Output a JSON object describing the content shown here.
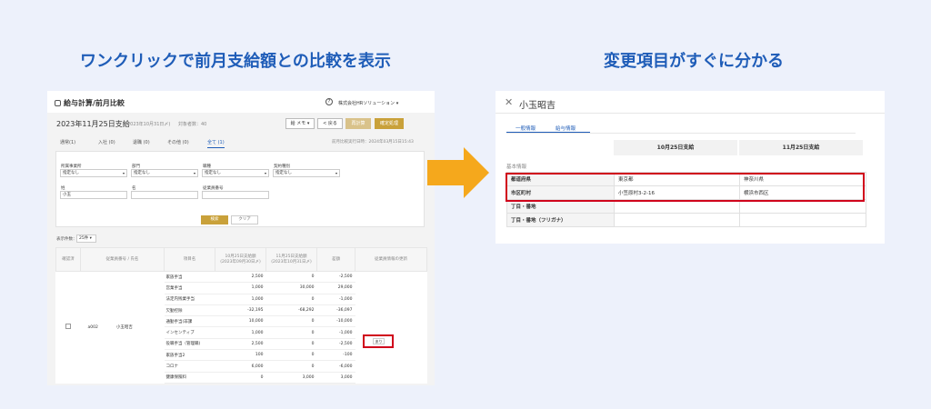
{
  "headlines": {
    "left": "ワンクリックで前月支給額との比較を表示",
    "right": "変更項目がすぐに分かる"
  },
  "left_screen": {
    "app_title": "給与計算/前月比較",
    "help_icon": "?",
    "company": "株式会社HRソリューション ▾",
    "pay_title": "2023年11月25日支給",
    "pay_meta": "(2023年10月31日〆)",
    "pay_count": "対象者数：40",
    "toolbar": {
      "memo": "給 メモ ▾",
      "back": "< 戻る",
      "recalc": "再計算",
      "confirm": "確定処理"
    },
    "tabs": [
      "通常(1)",
      "入社 (0)",
      "退職 (0)",
      "その他 (0)",
      "全て (1)"
    ],
    "last_calc": "前月比較実行日時：2024年03月15日15:43",
    "filters": {
      "office_label": "所属事業所",
      "office_value": "指定なし",
      "dept_label": "部門",
      "dept_value": "指定なし",
      "job_label": "職種",
      "job_value": "指定なし",
      "contract_label": "契約種別",
      "contract_value": "指定なし",
      "sei_label": "姓",
      "sei_value": "小玉",
      "mei_label": "名",
      "mei_value": "",
      "empno_label": "従業員番号",
      "empno_value": "",
      "search_button": "検索",
      "clear_button": "クリア"
    },
    "display_count_label": "表示件数：",
    "display_count_value": "25件 ▾",
    "table": {
      "headers": [
        "確認済",
        "従業員番号 / 氏名",
        "項目名",
        "10月25日支給額\n(2023年09月30日〆)",
        "11月25日支給額\n(2023年10月31日〆)",
        "差額",
        "従業員情報の更新"
      ],
      "employee_no": "a002",
      "employee_name": "小玉昭吉",
      "update_label": "あり",
      "rows": [
        {
          "item": "家族手当",
          "prev": "2,500",
          "curr": "0",
          "diff": "-2,500"
        },
        {
          "item": "営業手当",
          "prev": "1,000",
          "curr": "30,000",
          "diff": "29,000"
        },
        {
          "item": "法定内残業手当",
          "prev": "1,000",
          "curr": "0",
          "diff": "-1,000"
        },
        {
          "item": "欠勤控除",
          "prev": "-32,195",
          "curr": "-68,292",
          "diff": "-36,097"
        },
        {
          "item": "通勤手当(非課",
          "prev": "10,000",
          "curr": "0",
          "diff": "-10,000"
        },
        {
          "item": "インセンティブ",
          "prev": "1,000",
          "curr": "0",
          "diff": "-1,000"
        },
        {
          "item": "役職手当（管理職)",
          "prev": "2,500",
          "curr": "0",
          "diff": "-2,500"
        },
        {
          "item": "家族手当2",
          "prev": "100",
          "curr": "0",
          "diff": "-100"
        },
        {
          "item": "コロナ",
          "prev": "6,000",
          "curr": "0",
          "diff": "-6,000"
        },
        {
          "item": "健康保険料",
          "prev": "0",
          "curr": "3,000",
          "diff": "3,000"
        }
      ]
    }
  },
  "right_screen": {
    "employee_name": "小玉昭吉",
    "tabs": [
      "一般情報",
      "給与情報"
    ],
    "col_headers": [
      "10月25日支給",
      "11月25日支給"
    ],
    "section": "基本情報",
    "rows": [
      {
        "label": "都道府県",
        "prev": "東京都",
        "curr": "神奈川県"
      },
      {
        "label": "市区町村",
        "prev": "小笠原村3-2-16",
        "curr": "横浜市西区"
      },
      {
        "label": "丁目・番地",
        "prev": "",
        "curr": ""
      },
      {
        "label": "丁目・番地（フリガナ）",
        "prev": "",
        "curr": ""
      }
    ]
  },
  "colors": {
    "accent_blue": "#1f5db8",
    "gold_button": "#c9a13a",
    "highlight_red": "#d0011b",
    "arrow_orange": "#f5a81c",
    "background": "#edf1fb"
  }
}
